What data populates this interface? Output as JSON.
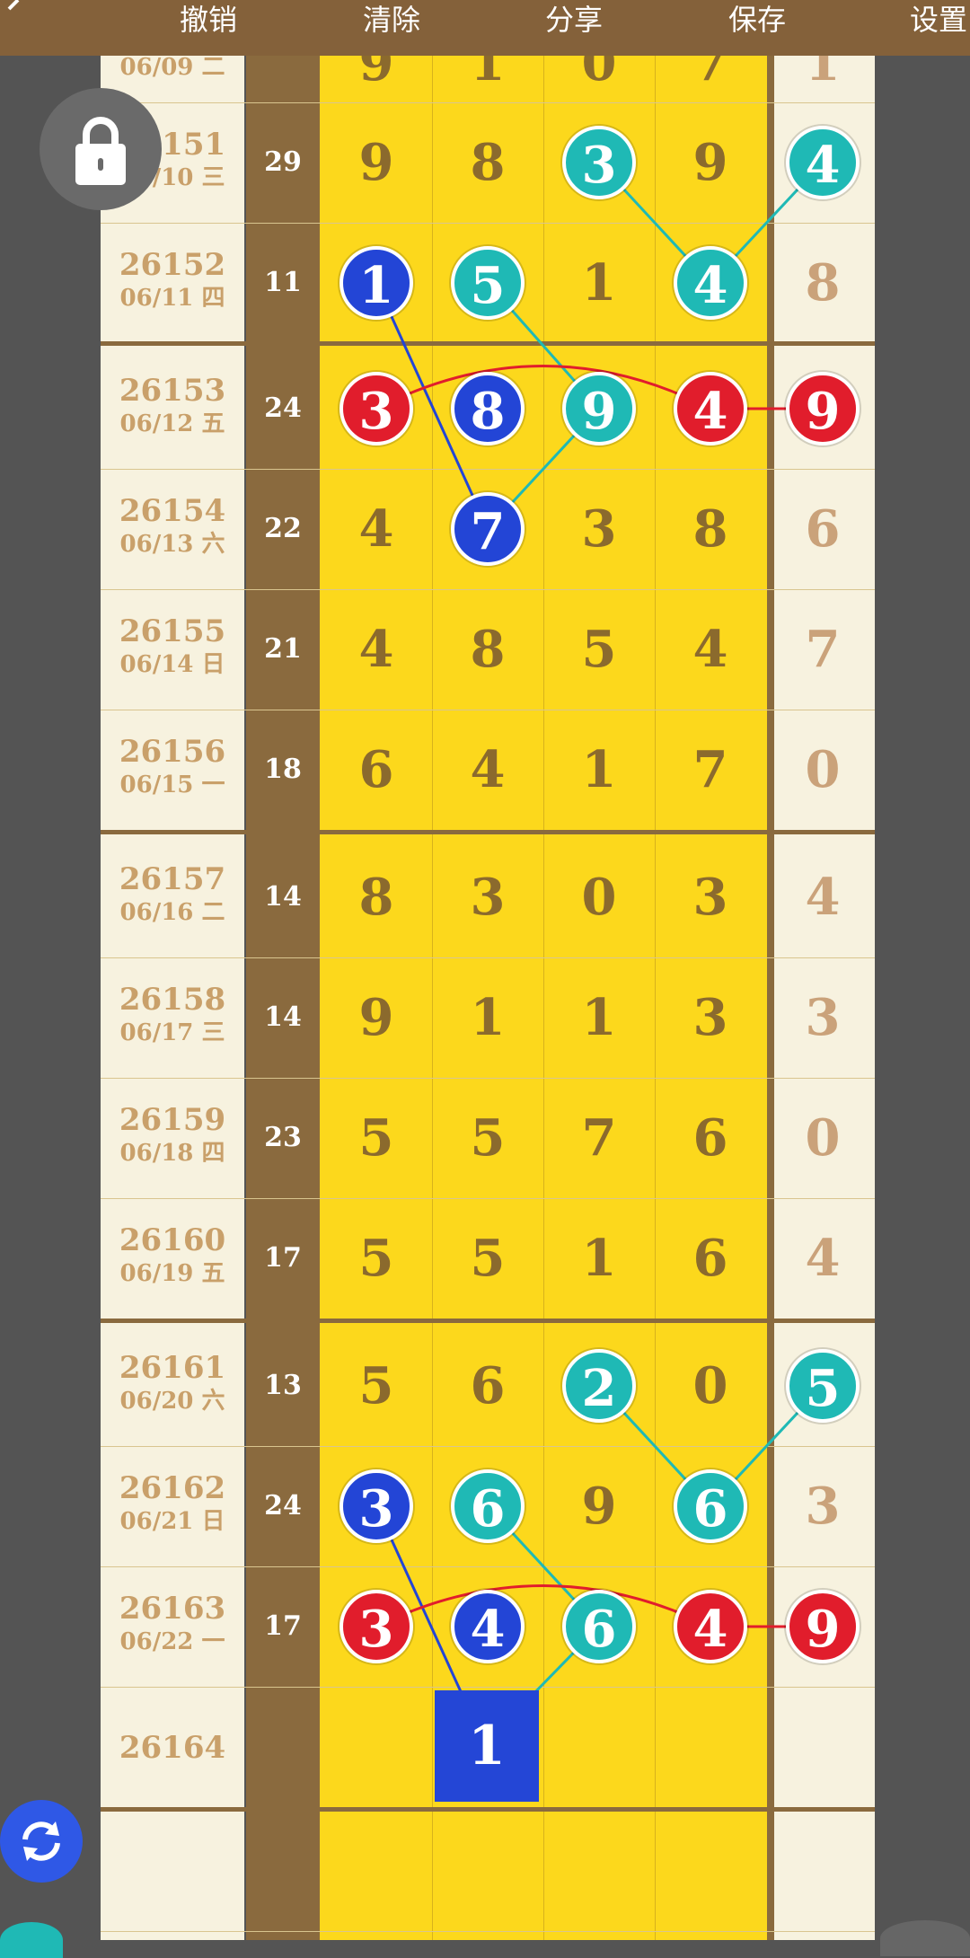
{
  "toolbar": {
    "undo_label": "撤销",
    "clear_label": "清除",
    "share_label": "分享",
    "save_label": "保存",
    "settings_label": "设置"
  },
  "partial_row": {
    "id": "",
    "date": "06/09 二"
  },
  "rows": [
    {
      "id": "26151",
      "date": "06/10 三",
      "sum": "29",
      "digits": [
        "9",
        "8",
        "3",
        "9"
      ],
      "last": "4"
    },
    {
      "id": "26152",
      "date": "06/11 四",
      "sum": "11",
      "digits": [
        "1",
        "5",
        "1",
        "4"
      ],
      "last": "8"
    },
    {
      "id": "26153",
      "date": "06/12 五",
      "sum": "24",
      "digits": [
        "3",
        "8",
        "9",
        "4"
      ],
      "last": "9"
    },
    {
      "id": "26154",
      "date": "06/13 六",
      "sum": "22",
      "digits": [
        "4",
        "7",
        "3",
        "8"
      ],
      "last": "6"
    },
    {
      "id": "26155",
      "date": "06/14 日",
      "sum": "21",
      "digits": [
        "4",
        "8",
        "5",
        "4"
      ],
      "last": "7"
    },
    {
      "id": "26156",
      "date": "06/15 一",
      "sum": "18",
      "digits": [
        "6",
        "4",
        "1",
        "7"
      ],
      "last": "0"
    },
    {
      "id": "26157",
      "date": "06/16 二",
      "sum": "14",
      "digits": [
        "8",
        "3",
        "0",
        "3"
      ],
      "last": "4"
    },
    {
      "id": "26158",
      "date": "06/17 三",
      "sum": "14",
      "digits": [
        "9",
        "1",
        "1",
        "3"
      ],
      "last": "3"
    },
    {
      "id": "26159",
      "date": "06/18 四",
      "sum": "23",
      "digits": [
        "5",
        "5",
        "7",
        "6"
      ],
      "last": "0"
    },
    {
      "id": "26160",
      "date": "06/19 五",
      "sum": "17",
      "digits": [
        "5",
        "5",
        "1",
        "6"
      ],
      "last": "4"
    },
    {
      "id": "26161",
      "date": "06/20 六",
      "sum": "13",
      "digits": [
        "5",
        "6",
        "2",
        "0"
      ],
      "last": "5"
    },
    {
      "id": "26162",
      "date": "06/21 日",
      "sum": "24",
      "digits": [
        "3",
        "6",
        "9",
        "6"
      ],
      "last": "3"
    },
    {
      "id": "26163",
      "date": "06/22 一",
      "sum": "17",
      "digits": [
        "3",
        "4",
        "6",
        "4"
      ],
      "last": "9"
    }
  ],
  "next_row": {
    "id": "26164",
    "selected_digit": "1"
  },
  "colors": {
    "toolbar": "#84613a",
    "digit_area": "#fcd81c",
    "id_column": "#f7f2df",
    "teal": "#1fb9b5",
    "blue": "#2345d6",
    "red": "#e11d2c"
  },
  "icons": {
    "lock": "lock-icon",
    "refresh": "refresh-icon",
    "back": "back-arrow-icon"
  }
}
